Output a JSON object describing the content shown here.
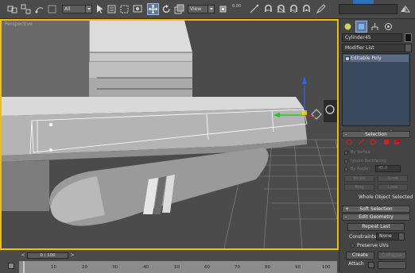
{
  "toolbar": {
    "selection_filter": "All",
    "ref_coord": "View",
    "spinner_label": "0.00"
  },
  "viewport": {
    "label": "Perspective"
  },
  "panel": {
    "object_name": "Cylinder45",
    "modifier_list": "Modifier List",
    "stack_item": "Editable Poly",
    "selection_rollout": "Selection",
    "by_vertex": "By Vertex",
    "ignore_backfacing": "Ignore Backfacing",
    "by_angle": "By Angle:",
    "angle_value": "45.0",
    "shrink": "Shrink",
    "grow": "Grow",
    "ring": "Ring",
    "loop": "Loop",
    "status": "Whole Object Selected",
    "soft_selection": "Soft Selection",
    "edit_geometry": "Edit Geometry",
    "repeat_last": "Repeat Last",
    "constraints_label": "Constraints:",
    "constraints_value": "None",
    "preserve_uvs": "Preserve UVs",
    "create": "Create",
    "collapse": "Collapse",
    "attach": "Attach"
  },
  "timeline": {
    "frame_display": "0 / 100",
    "ticks": [
      "10",
      "20",
      "30",
      "40",
      "50",
      "60",
      "70",
      "80",
      "90",
      "100"
    ]
  },
  "colors": {
    "viewport_border": "#f2c000",
    "selection_blue": "#5a7aa6",
    "stack_bg": "#3a4a5e",
    "red_icon": "#d22020"
  }
}
